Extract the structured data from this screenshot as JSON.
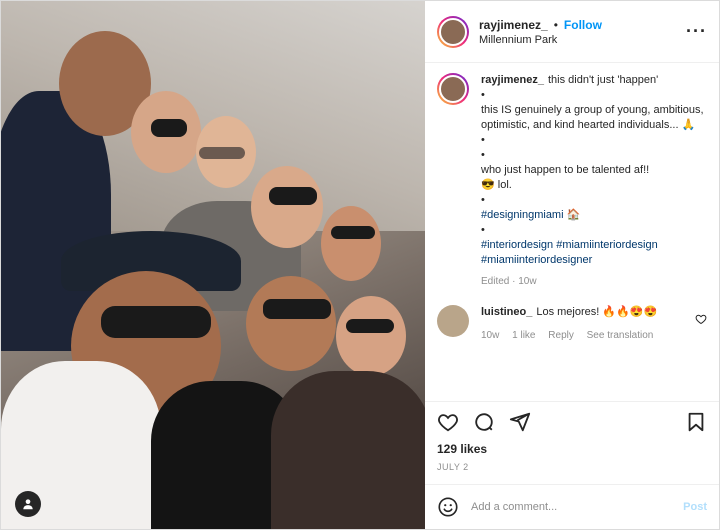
{
  "header": {
    "username": "rayjimenez_",
    "separator": "•",
    "follow_label": "Follow",
    "location": "Millennium Park",
    "more_icon": "more-horizontal-icon"
  },
  "caption": {
    "username": "rayjimenez_",
    "lines": [
      "this didn't just 'happen'",
      "•",
      "this IS genuinely a group of young, ambitious, optimistic, and kind hearted individuals... 🙏",
      "•",
      "•",
      "who just happen to be talented af!!",
      "😎 lol.",
      "•",
      "#designingmiami 🏠",
      "•",
      "#interiordesign #miamiinteriordesign",
      "#miamiinteriordesigner"
    ],
    "edited": "Edited · 10w"
  },
  "comment": {
    "username": "luistineo_",
    "text": "Los mejores! 🔥🔥😍😍",
    "age": "10w",
    "likes": "1 like",
    "reply": "Reply",
    "translate": "See translation"
  },
  "likes_text": "129 likes",
  "date_text": "JULY 2",
  "add_comment": {
    "placeholder": "Add a comment...",
    "post_label": "Post"
  },
  "colors": {
    "link": "#0095f6",
    "hashtag": "#00376b",
    "muted": "#8e8e8e"
  }
}
